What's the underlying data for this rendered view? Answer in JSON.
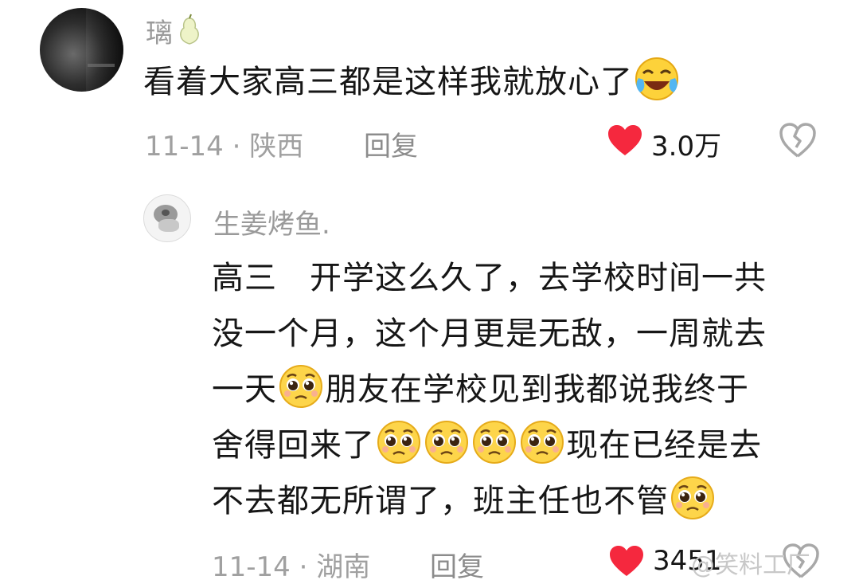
{
  "comments": [
    {
      "username": "璃",
      "badge_icon": "pear-icon",
      "text": "看着大家高三都是这样我就放心了",
      "trailing_emoji": "laughing-tears-emoji",
      "date": "11-14",
      "separator": "·",
      "location": "陕西",
      "reply_label": "回复",
      "likes": "3.0万",
      "liked": true
    },
    {
      "username": "生姜烤鱼.",
      "lines": [
        "高三　开学这么久了，去学校时间一共",
        "没一个月，这个月更是无敌，一周就去",
        "一天",
        "朋友在学校见到我都说我终于",
        "舍得回来了",
        "现在已经是去",
        "不去都无所谓了，班主任也不管"
      ],
      "emoji_name": "pleading-face-emoji",
      "date": "11-14",
      "separator": "·",
      "location": "湖南",
      "reply_label": "回复",
      "likes": "3451",
      "liked": true
    }
  ],
  "watermark": "@笑料工厂",
  "colors": {
    "heart": "#f5283e",
    "meta_gray": "#a0a0a0",
    "text": "#161616"
  }
}
